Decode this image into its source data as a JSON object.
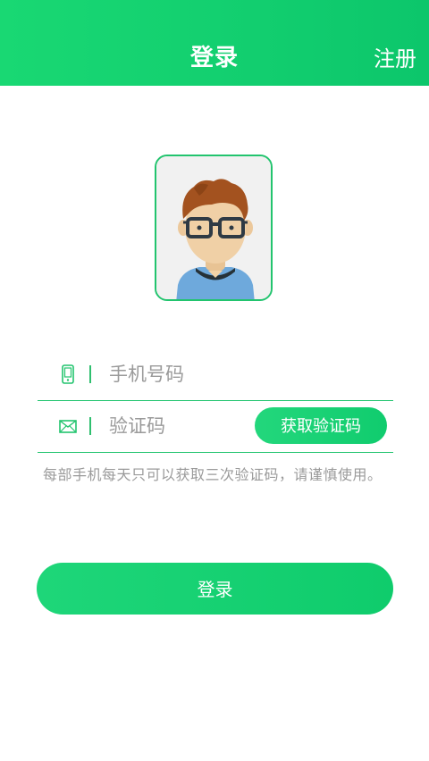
{
  "header": {
    "title": "登录",
    "register_label": "注册"
  },
  "form": {
    "phone": {
      "icon": "phone-icon",
      "placeholder": "手机号码",
      "value": ""
    },
    "code": {
      "icon": "mail-icon",
      "placeholder": "验证码",
      "value": "",
      "get_code_label": "获取验证码"
    },
    "notice": "每部手机每天只可以获取三次验证码，请谨慎使用。"
  },
  "login_button_label": "登录",
  "colors": {
    "accent": "#12ce6f",
    "divider": "#1fc46d",
    "hint_text": "#9a9a9a"
  }
}
